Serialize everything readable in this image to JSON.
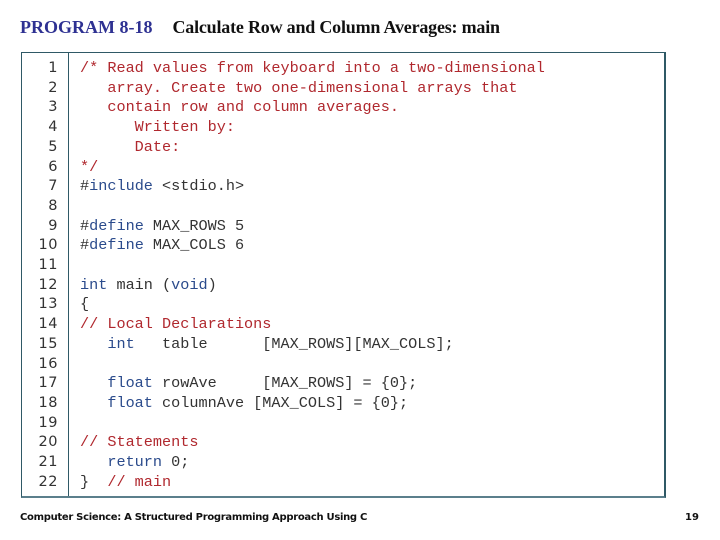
{
  "header": {
    "program_label": "PROGRAM 8-18",
    "program_title": "Calculate Row and Column Averages: main"
  },
  "code": {
    "lines": [
      {
        "n": "1",
        "tokens": [
          {
            "t": "/* Read values from keyboard into a two-dimensional",
            "c": "cm"
          }
        ]
      },
      {
        "n": "2",
        "tokens": [
          {
            "t": "   array. Create two one-dimensional arrays that",
            "c": "cm"
          }
        ]
      },
      {
        "n": "3",
        "tokens": [
          {
            "t": "   contain row and column averages.",
            "c": "cm"
          }
        ]
      },
      {
        "n": "4",
        "tokens": [
          {
            "t": "      Written by:",
            "c": "cm"
          }
        ]
      },
      {
        "n": "5",
        "tokens": [
          {
            "t": "      Date:",
            "c": "cm"
          }
        ]
      },
      {
        "n": "6",
        "tokens": [
          {
            "t": "*/",
            "c": "cm"
          }
        ]
      },
      {
        "n": "7",
        "tokens": [
          {
            "t": "#",
            "c": "pp"
          },
          {
            "t": "include",
            "c": "kw"
          },
          {
            "t": " <stdio.h>",
            "c": ""
          }
        ]
      },
      {
        "n": "8",
        "tokens": []
      },
      {
        "n": "9",
        "tokens": [
          {
            "t": "#",
            "c": "pp"
          },
          {
            "t": "define",
            "c": "kw"
          },
          {
            "t": " MAX_ROWS 5",
            "c": ""
          }
        ]
      },
      {
        "n": "10",
        "tokens": [
          {
            "t": "#",
            "c": "pp"
          },
          {
            "t": "define",
            "c": "kw"
          },
          {
            "t": " MAX_COLS 6",
            "c": ""
          }
        ]
      },
      {
        "n": "11",
        "tokens": []
      },
      {
        "n": "12",
        "tokens": [
          {
            "t": "int",
            "c": "kw"
          },
          {
            "t": " main (",
            "c": ""
          },
          {
            "t": "void",
            "c": "kw"
          },
          {
            "t": ")",
            "c": ""
          }
        ]
      },
      {
        "n": "13",
        "tokens": [
          {
            "t": "{",
            "c": ""
          }
        ]
      },
      {
        "n": "14",
        "tokens": [
          {
            "t": "// Local Declarations",
            "c": "cm"
          }
        ]
      },
      {
        "n": "15",
        "tokens": [
          {
            "t": "   ",
            "c": ""
          },
          {
            "t": "int",
            "c": "kw"
          },
          {
            "t": "   table      [MAX_ROWS][MAX_COLS];",
            "c": ""
          }
        ]
      },
      {
        "n": "16",
        "tokens": []
      },
      {
        "n": "17",
        "tokens": [
          {
            "t": "   ",
            "c": ""
          },
          {
            "t": "float",
            "c": "kw"
          },
          {
            "t": " rowAve     [MAX_ROWS] = {0};",
            "c": ""
          }
        ]
      },
      {
        "n": "18",
        "tokens": [
          {
            "t": "   ",
            "c": ""
          },
          {
            "t": "float",
            "c": "kw"
          },
          {
            "t": " columnAve [MAX_COLS] = {0};",
            "c": ""
          }
        ]
      },
      {
        "n": "19",
        "tokens": []
      },
      {
        "n": "20",
        "tokens": [
          {
            "t": "// Statements",
            "c": "cm"
          }
        ]
      },
      {
        "n": "21",
        "tokens": [
          {
            "t": "   ",
            "c": ""
          },
          {
            "t": "return",
            "c": "kw"
          },
          {
            "t": " 0;",
            "c": ""
          }
        ]
      },
      {
        "n": "22",
        "tokens": [
          {
            "t": "}  ",
            "c": ""
          },
          {
            "t": "// main",
            "c": "cm"
          }
        ]
      }
    ]
  },
  "footer": {
    "book_title": "Computer Science: A Structured Programming Approach Using C",
    "page_number": "19"
  },
  "colors": {
    "program_label": "#2e3192",
    "comment": "#b0282e",
    "keyword": "#2b4b8c",
    "text": "#333333",
    "border": "#2f5966"
  }
}
